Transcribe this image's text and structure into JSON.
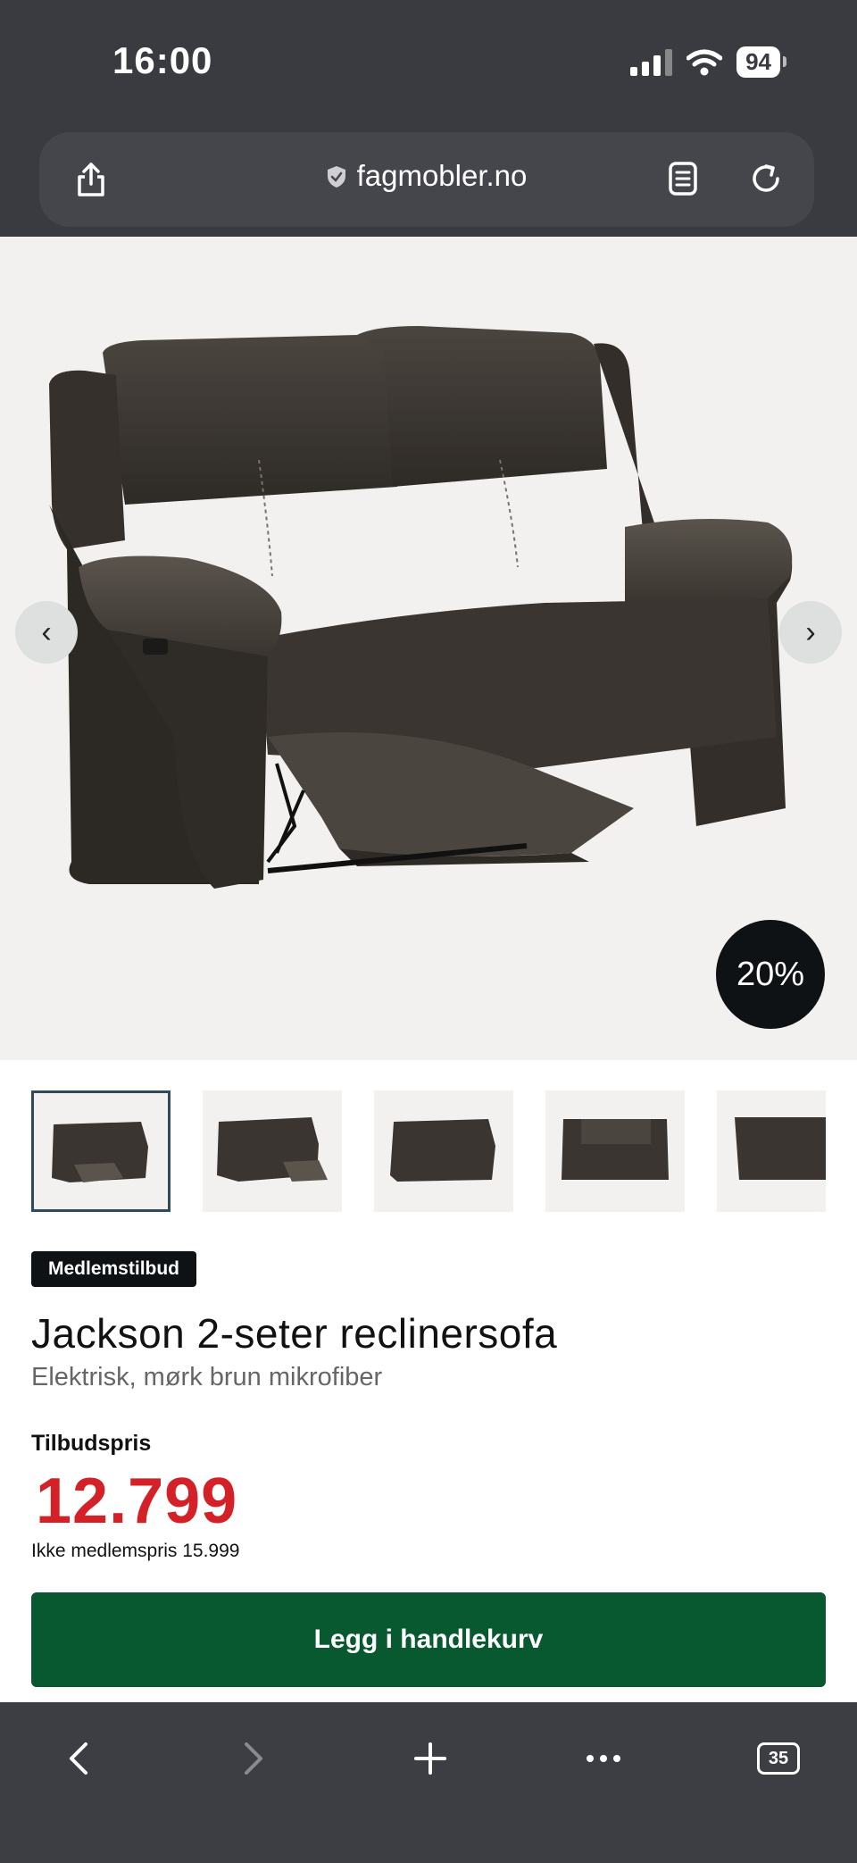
{
  "status_bar": {
    "time": "16:00",
    "battery": "94"
  },
  "browser": {
    "url": "fagmobler.no",
    "tabs_count": "35"
  },
  "product": {
    "discount_badge": "20%",
    "member_tag": "Medlemstilbud",
    "title": "Jackson 2-seter reclinersofa",
    "subtitle": "Elektrisk, mørk brun mikrofiber",
    "price_label": "Tilbudspris",
    "price": "12.799",
    "regular_price": "Ikke medlemspris 15.999",
    "add_to_cart_label": "Legg i handlekurv"
  },
  "icons": {
    "share": "share-icon",
    "shield": "shield-icon",
    "reader": "reader-icon",
    "reload": "reload-icon",
    "prev": "chevron-left-icon",
    "next": "chevron-right-icon",
    "back": "back-icon",
    "forward": "forward-icon",
    "new_tab": "plus-icon",
    "more": "more-icon"
  },
  "colors": {
    "price": "#d42027",
    "cart_button": "#08592f",
    "badge": "#0e1214"
  }
}
